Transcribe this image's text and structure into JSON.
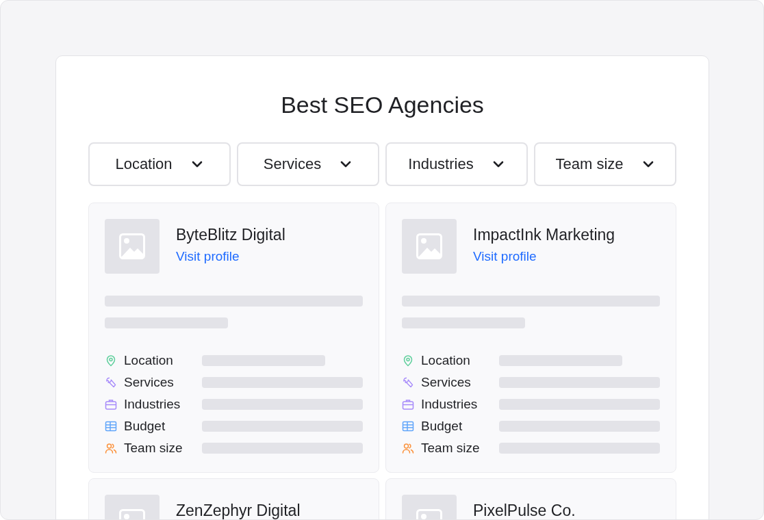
{
  "title": "Best SEO Agencies",
  "filters": [
    {
      "label": "Location"
    },
    {
      "label": "Services"
    },
    {
      "label": "Industries"
    },
    {
      "label": "Team size"
    }
  ],
  "agencies": [
    {
      "name": "ByteBlitz Digital",
      "link": "Visit profile",
      "fields": [
        {
          "kind": "location",
          "label": "Location"
        },
        {
          "kind": "services",
          "label": "Services"
        },
        {
          "kind": "industries",
          "label": "Industries"
        },
        {
          "kind": "budget",
          "label": "Budget"
        },
        {
          "kind": "team",
          "label": "Team size"
        }
      ]
    },
    {
      "name": "ImpactInk Marketing",
      "link": "Visit profile",
      "fields": [
        {
          "kind": "location",
          "label": "Location"
        },
        {
          "kind": "services",
          "label": "Services"
        },
        {
          "kind": "industries",
          "label": "Industries"
        },
        {
          "kind": "budget",
          "label": "Budget"
        },
        {
          "kind": "team",
          "label": "Team size"
        }
      ]
    },
    {
      "name": "ZenZephyr Digital"
    },
    {
      "name": "PixelPulse Co."
    }
  ]
}
